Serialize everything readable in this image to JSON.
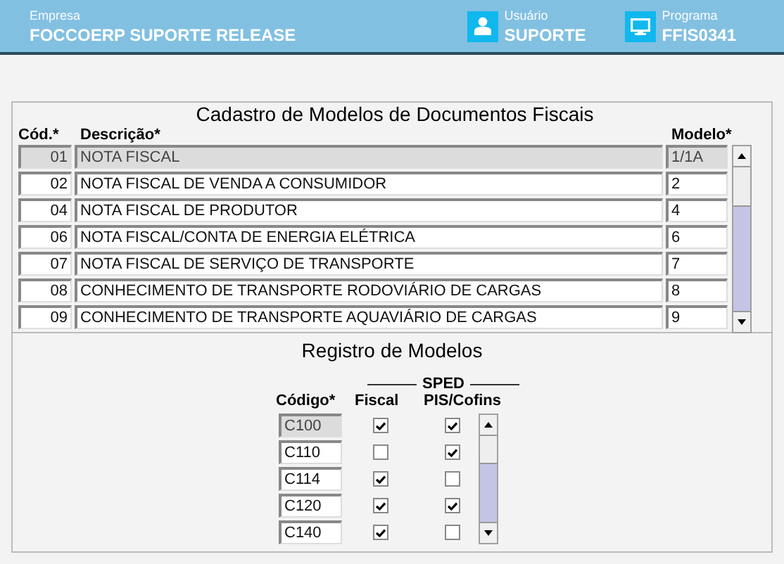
{
  "header": {
    "company_label": "Empresa",
    "company": "FOCCOERP SUPORTE RELEASE",
    "user_label": "Usuário",
    "user": "SUPORTE",
    "program_label": "Programa",
    "program": "FFIS0341"
  },
  "documents": {
    "title": "Cadastro de Modelos de Documentos Fiscais",
    "columns": [
      "Cód.*",
      "Descrição*",
      "Modelo*"
    ],
    "rows": [
      {
        "code": "01",
        "description": "NOTA FISCAL",
        "model": "1/1A",
        "selected": true
      },
      {
        "code": "02",
        "description": "NOTA FISCAL DE VENDA A CONSUMIDOR",
        "model": "2",
        "selected": false
      },
      {
        "code": "04",
        "description": "NOTA FISCAL DE PRODUTOR",
        "model": "4",
        "selected": false
      },
      {
        "code": "06",
        "description": "NOTA FISCAL/CONTA DE ENERGIA ELÉTRICA",
        "model": "6",
        "selected": false
      },
      {
        "code": "07",
        "description": "NOTA FISCAL DE SERVIÇO DE TRANSPORTE",
        "model": "7",
        "selected": false
      },
      {
        "code": "08",
        "description": "CONHECIMENTO DE TRANSPORTE RODOVIÁRIO DE CARGAS",
        "model": "8",
        "selected": false
      },
      {
        "code": "09",
        "description": "CONHECIMENTO DE TRANSPORTE AQUAVIÁRIO DE CARGAS",
        "model": "9",
        "selected": false
      }
    ]
  },
  "registry": {
    "title": "Registro de Modelos",
    "group_label": "SPED",
    "columns": [
      "Código*",
      "Fiscal",
      "PIS/Cofins"
    ],
    "rows": [
      {
        "code": "C100",
        "fiscal": true,
        "pis_cofins": true,
        "selected": true
      },
      {
        "code": "C110",
        "fiscal": false,
        "pis_cofins": true,
        "selected": false
      },
      {
        "code": "C114",
        "fiscal": true,
        "pis_cofins": false,
        "selected": false
      },
      {
        "code": "C120",
        "fiscal": true,
        "pis_cofins": true,
        "selected": false
      },
      {
        "code": "C140",
        "fiscal": true,
        "pis_cofins": false,
        "selected": false
      }
    ]
  }
}
